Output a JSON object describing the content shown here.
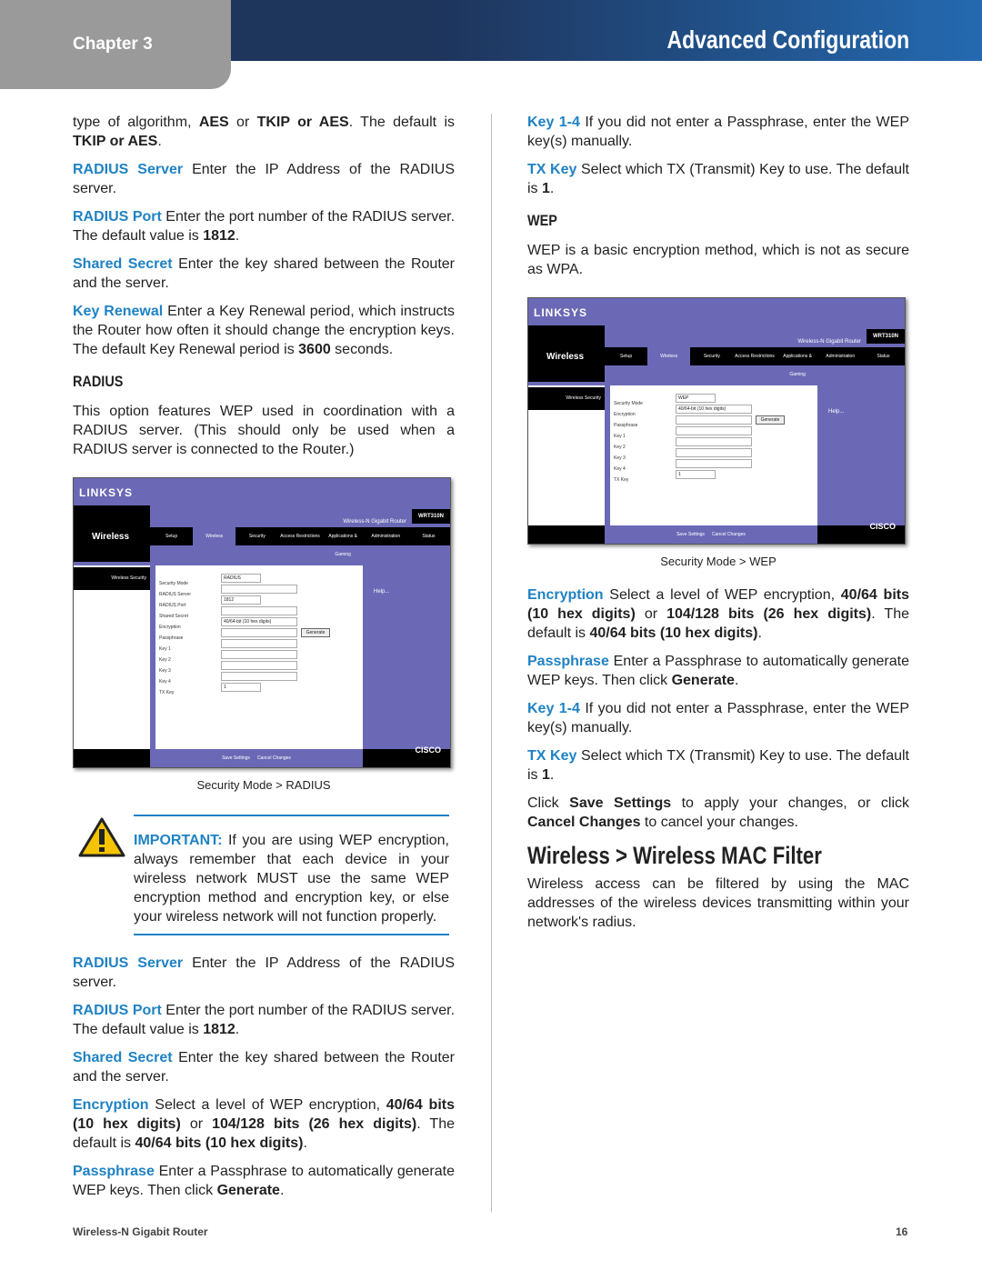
{
  "header": {
    "chapter": "Chapter 3",
    "title": "Advanced Configuration"
  },
  "left": {
    "p0": {
      "a": "type of algorithm, ",
      "b1": "AES",
      "c": " or ",
      "b2": "TKIP or AES",
      "d": ". The default is ",
      "b3": "TKIP or AES",
      "e": "."
    },
    "radius_server1": {
      "term": "RADIUS Server",
      "text": "  Enter the IP Address of the RADIUS server."
    },
    "radius_port1": {
      "term": "RADIUS Port",
      "text": "  Enter the port number of the RADIUS server. The default value is ",
      "val": "1812",
      "end": "."
    },
    "shared_secret1": {
      "term": "Shared Secret",
      "text": "  Enter the key shared between the Router and the server."
    },
    "key_renewal": {
      "term": "Key Renewal",
      "text": "  Enter a Key Renewal period, which instructs the Router how often it should change the encryption keys. The default Key Renewal period is ",
      "val": "3600",
      "end": " seconds."
    },
    "radius_heading": "RADIUS",
    "radius_intro": "This option features WEP used in coordination with a RADIUS server. (This should only be used when a RADIUS server is connected to the Router.)",
    "caption": "Security Mode > RADIUS",
    "important": {
      "label": "IMPORTANT:",
      "text": " If you are using WEP encryption, always remember that each device in your wireless network MUST use the same WEP encryption method and encryption key, or else your wireless network will not function properly."
    },
    "radius_server2": {
      "term": "RADIUS Server",
      "text": "  Enter the IP Address of the RADIUS server."
    },
    "radius_port2": {
      "term": "RADIUS Port",
      "text": "  Enter the port number of the RADIUS server. The default value is ",
      "val": "1812",
      "end": "."
    },
    "shared_secret2": {
      "term": "Shared Secret",
      "text": "  Enter the key shared between the Router and the server."
    },
    "encryption": {
      "term": "Encryption",
      "a": "  Select a level of WEP encryption, ",
      "b1": "40/64 bits (10 hex digits)",
      "c": " or ",
      "b2": "104/128 bits (26 hex digits)",
      "d": ". The default is ",
      "b3": "40/64 bits (10 hex digits)",
      "e": "."
    },
    "passphrase": {
      "term": "Passphrase",
      "a": "  Enter a Passphrase to automatically generate WEP keys. Then click ",
      "b": "Generate",
      "c": "."
    }
  },
  "right": {
    "key14a": {
      "term": "Key 1-4",
      "text": "  If you did not enter a Passphrase, enter the WEP key(s) manually."
    },
    "txkey_a": {
      "term": "TX Key",
      "text": "  Select which TX (Transmit) Key to use. The default is ",
      "val": "1",
      "end": "."
    },
    "wep_heading": "WEP",
    "wep_intro": "WEP is a basic encryption method, which is not as secure as WPA.",
    "caption": "Security Mode > WEP",
    "encryption": {
      "term": "Encryption",
      "a": "  Select a level of WEP encryption, ",
      "b1": "40/64 bits (10 hex digits)",
      "c": " or ",
      "b2": "104/128 bits (26 hex digits)",
      "d": ". The default is ",
      "b3": "40/64 bits (10 hex digits)",
      "e": "."
    },
    "passphrase": {
      "term": "Passphrase",
      "a": "  Enter a Passphrase to automatically generate WEP keys. Then click ",
      "b": "Generate",
      "c": "."
    },
    "key14b": {
      "term": "Key 1-4",
      "text": "  If you did not enter a Passphrase, enter the WEP key(s) manually."
    },
    "txkey_b": {
      "term": "TX Key",
      "text": "  Select which TX (Transmit) Key to use. The default is ",
      "val": "1",
      "end": "."
    },
    "save": {
      "a": "Click ",
      "b1": "Save Settings",
      "c": " to apply your changes, or click ",
      "b2": "Cancel Changes",
      "d": " to cancel your changes."
    },
    "mac_heading": "Wireless > Wireless MAC Filter",
    "mac_intro": "Wireless access can be filtered by using the MAC addresses of the wireless devices transmitting within your network's radius."
  },
  "screens": {
    "logo": "LINKSYS",
    "section": "Wireless",
    "product": "Wireless-N Gigabit Router",
    "model": "WRT310N",
    "tabs": [
      "Setup",
      "Wireless",
      "Security",
      "Access Restrictions",
      "Applications & Gaming",
      "Administration",
      "Status"
    ],
    "side_label": "Wireless Security",
    "help": "Help...",
    "save": "Save Settings",
    "cancel": "Cancel Changes",
    "cisco": "CISCO",
    "radius": {
      "mode": "RADIUS",
      "fields": [
        "Security Mode",
        "RADIUS Server",
        "RADIUS Port",
        "Shared Secret",
        "Encryption",
        "Passphrase",
        "Key 1",
        "Key 2",
        "Key 3",
        "Key 4",
        "TX Key"
      ],
      "port": "1812",
      "enc": "40/64-bit (10 hex digits)",
      "generate": "Generate",
      "tx": "1"
    },
    "wep": {
      "mode": "WEP",
      "fields": [
        "Security Mode",
        "Encryption",
        "Passphrase",
        "Key 1",
        "Key 2",
        "Key 3",
        "Key 4",
        "TX Key"
      ],
      "enc": "40/64-bit (10 hex digits)",
      "generate": "Generate",
      "tx": "1"
    }
  },
  "footer": {
    "product": "Wireless-N Gigabit Router",
    "page": "16"
  },
  "colors": {
    "accent": "#1f82c3",
    "header_dark": "#1e355c",
    "header_light": "#2469b0",
    "tab_gray": "#9a9a9a"
  }
}
